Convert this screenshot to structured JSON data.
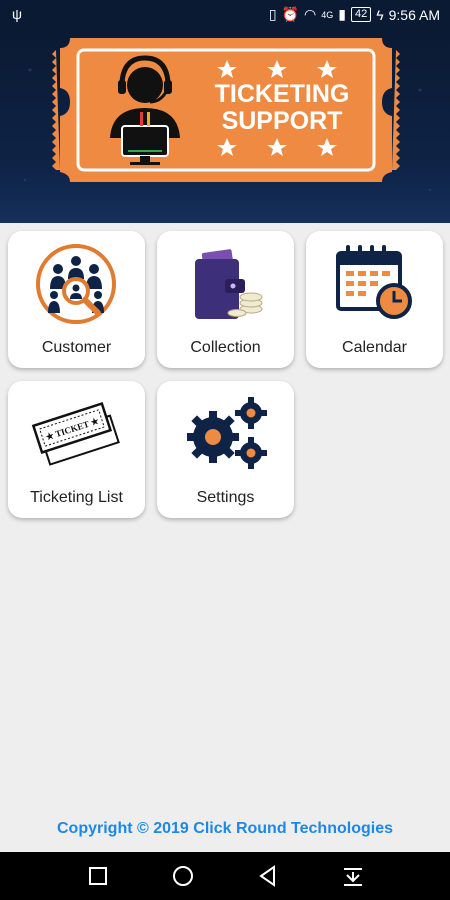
{
  "status_bar": {
    "time": "9:56 AM",
    "battery": "42",
    "network": "4G",
    "icons": [
      "usb-icon",
      "vibrate-icon",
      "alarm-icon",
      "wifi-icon",
      "signal-icon",
      "battery-icon"
    ]
  },
  "header": {
    "banner_line1": "TICKETING",
    "banner_line2": "SUPPORT",
    "banner_color": "#ef8a43"
  },
  "tiles": [
    {
      "label": "Customer",
      "icon": "customer-search-icon"
    },
    {
      "label": "Collection",
      "icon": "wallet-icon"
    },
    {
      "label": "Calendar",
      "icon": "calendar-icon"
    },
    {
      "label": "Ticketing List",
      "icon": "ticket-icon"
    },
    {
      "label": "Settings",
      "icon": "gears-icon"
    }
  ],
  "footer": {
    "copyright": "Copyright © 2019 Click Round Technologies"
  },
  "nav": {
    "icons": [
      "recents-icon",
      "home-icon",
      "back-icon",
      "notification-pull-icon"
    ]
  },
  "colors": {
    "accent_orange": "#ef8a43",
    "navy": "#0e2346",
    "footer_blue": "#1e88e5"
  }
}
